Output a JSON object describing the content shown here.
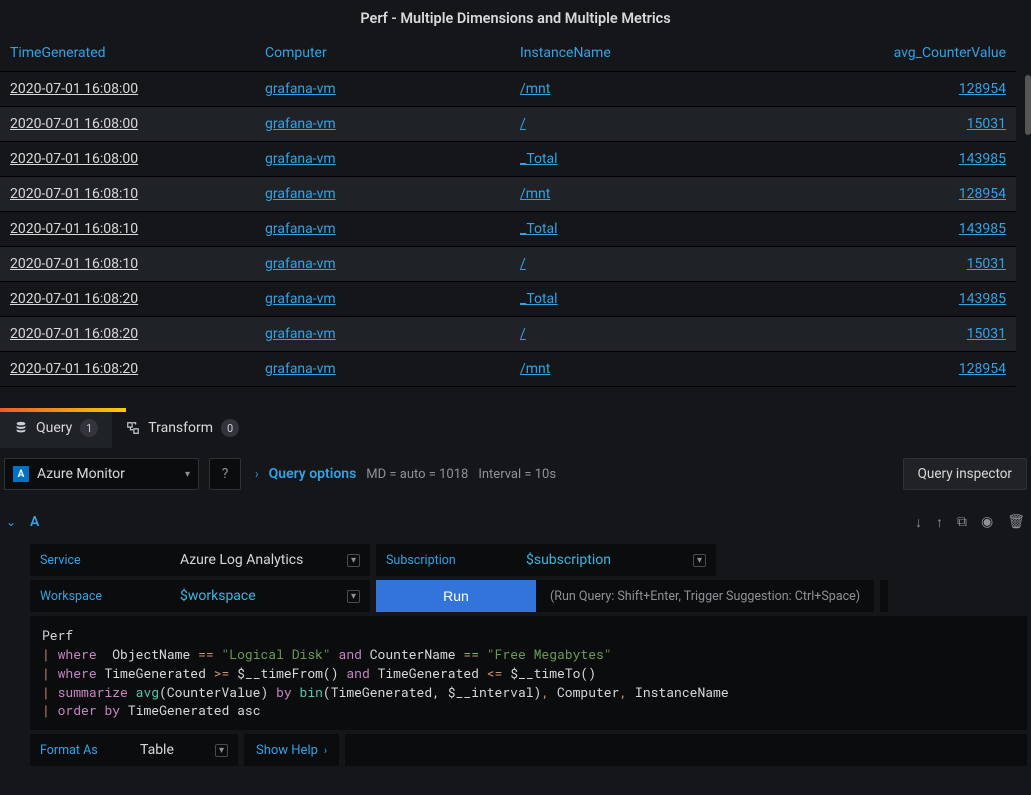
{
  "panel": {
    "title": "Perf - Multiple Dimensions and Multiple Metrics",
    "columns": [
      "TimeGenerated",
      "Computer",
      "InstanceName",
      "avg_CounterValue"
    ],
    "rows": [
      {
        "time": "2020-07-01 16:08:00",
        "computer": "grafana-vm",
        "instance": "/mnt",
        "value": "128954"
      },
      {
        "time": "2020-07-01 16:08:00",
        "computer": "grafana-vm",
        "instance": "/",
        "value": "15031"
      },
      {
        "time": "2020-07-01 16:08:00",
        "computer": "grafana-vm",
        "instance": "_Total",
        "value": "143985"
      },
      {
        "time": "2020-07-01 16:08:10",
        "computer": "grafana-vm",
        "instance": "/mnt",
        "value": "128954"
      },
      {
        "time": "2020-07-01 16:08:10",
        "computer": "grafana-vm",
        "instance": "_Total",
        "value": "143985"
      },
      {
        "time": "2020-07-01 16:08:10",
        "computer": "grafana-vm",
        "instance": "/",
        "value": "15031"
      },
      {
        "time": "2020-07-01 16:08:20",
        "computer": "grafana-vm",
        "instance": "_Total",
        "value": "143985"
      },
      {
        "time": "2020-07-01 16:08:20",
        "computer": "grafana-vm",
        "instance": "/",
        "value": "15031"
      },
      {
        "time": "2020-07-01 16:08:20",
        "computer": "grafana-vm",
        "instance": "/mnt",
        "value": "128954"
      }
    ]
  },
  "tabs": {
    "query": {
      "label": "Query",
      "count": "1"
    },
    "transform": {
      "label": "Transform",
      "count": "0"
    }
  },
  "toolbar": {
    "datasource": "Azure Monitor",
    "query_options_label": "Query options",
    "md_info": "MD = auto = 1018",
    "interval_info": "Interval = 10s",
    "inspector_label": "Query inspector"
  },
  "query": {
    "refid": "A",
    "service_label": "Service",
    "service_value": "Azure Log Analytics",
    "subscription_label": "Subscription",
    "subscription_value": "$subscription",
    "workspace_label": "Workspace",
    "workspace_value": "$workspace",
    "run_label": "Run",
    "run_hint": "(Run Query: Shift+Enter, Trigger Suggestion: Ctrl+Space)",
    "format_label": "Format As",
    "format_value": "Table",
    "show_help": "Show Help"
  },
  "code": {
    "l1": "Perf",
    "l2a": "where",
    "l2b": "ObjectName",
    "l2c": "==",
    "l2d": "\"Logical Disk\"",
    "l2e": "and",
    "l2f": "CounterName",
    "l2g": "==",
    "l2h": "\"Free Megabytes\"",
    "l3a": "where",
    "l3b": "TimeGenerated",
    "l3c": ">=",
    "l3d": "$__timeFrom()",
    "l3e": "and",
    "l3f": "TimeGenerated",
    "l3g": "<=",
    "l3h": "$__timeTo()",
    "l4a": "summarize",
    "l4b": "avg",
    "l4c": "(CounterValue)",
    "l4d": "by",
    "l4e": "bin",
    "l4f": "(TimeGenerated, $__interval)",
    "l4g": ",",
    "l4h": "Computer",
    "l4i": ",",
    "l4j": "InstanceName",
    "l5a": "order",
    "l5b": "by",
    "l5c": "TimeGenerated asc"
  }
}
